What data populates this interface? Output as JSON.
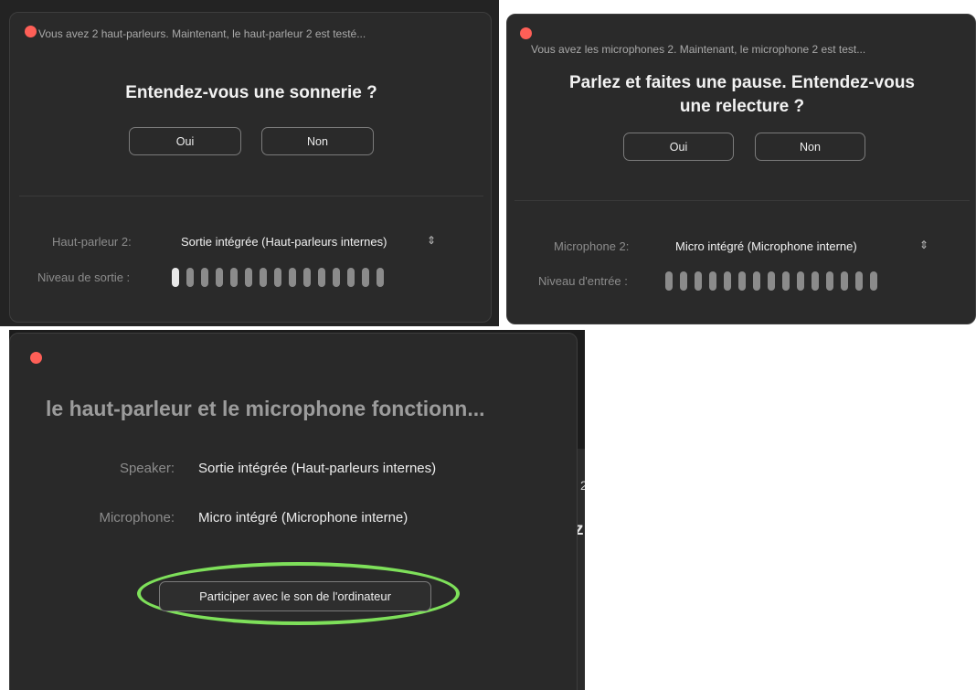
{
  "speaker_test": {
    "status": "Vous avez 2 haut-parleurs. Maintenant, le haut-parleur 2 est testé...",
    "question": "Entendez-vous une sonnerie ?",
    "yes_label": "Oui",
    "no_label": "Non",
    "device_label": "Haut-parleur 2:",
    "device_value": "Sortie intégrée (Haut-parleurs internes)",
    "level_label": "Niveau de sortie :",
    "level_segments_total": 15,
    "level_segments_active": 1
  },
  "mic_test": {
    "status": "Vous avez les microphones 2. Maintenant, le microphone 2 est test...",
    "question_line1": "Parlez et faites une pause. Entendez-vous",
    "question_line2": "une relecture ?",
    "yes_label": "Oui",
    "no_label": "Non",
    "device_label": "Microphone 2:",
    "device_value": "Micro intégré (Microphone interne)",
    "level_label": "Niveau d'entrée :",
    "level_segments_total": 15,
    "level_segments_active": 0
  },
  "result": {
    "title": "le haut-parleur et le microphone fonctionn...",
    "speaker_label": "Speaker:",
    "speaker_value": "Sortie intégrée (Haut-parleurs internes)",
    "microphone_label": "Microphone:",
    "microphone_value": "Micro intégré (Microphone interne)",
    "join_button": "Participer avec le son de l'ordinateur",
    "edge_fragment_1": "2",
    "edge_fragment_2": "z"
  },
  "colors": {
    "close_button": "#fe5f57",
    "highlight": "#7ee05a",
    "meter_active": "#e9e9e9",
    "meter_inactive": "#8b8b8b"
  },
  "icons": {
    "close": "close-dot-icon",
    "select_chevron": "up-down-chevron-icon"
  }
}
